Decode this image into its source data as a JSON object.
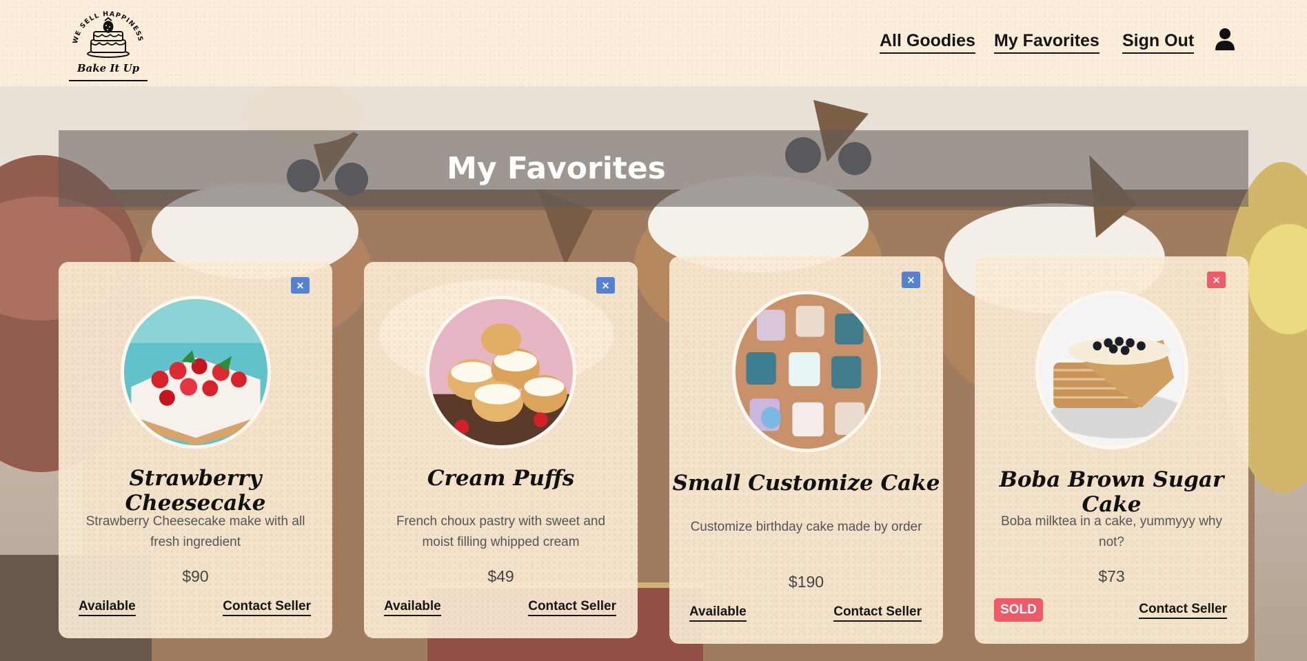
{
  "header": {
    "logo_arc_text": "WE SELL HAPPINESS",
    "logo_script": "Bake It Up",
    "nav": [
      {
        "label": "All Goodies"
      },
      {
        "label": "My Favorites"
      },
      {
        "label": "Sign Out"
      }
    ],
    "user_icon": "user-icon"
  },
  "page": {
    "title": "My Favorites"
  },
  "cards": [
    {
      "name": "Strawberry Cheesecake",
      "description": "Strawberry Cheesecake make with all fresh ingredient",
      "price": "$90",
      "status": "Available",
      "contact": "Contact Seller",
      "remove_icon": "×"
    },
    {
      "name": "Cream Puffs",
      "description": "French choux pastry with sweet and moist filling whipped cream",
      "price": "$49",
      "status": "Available",
      "contact": "Contact Seller",
      "remove_icon": "×"
    },
    {
      "name": "Small Customize Cake",
      "description": "Customize birthday cake made by order",
      "price": "$190",
      "status": "Available",
      "contact": "Contact Seller",
      "remove_icon": "×"
    },
    {
      "name": "Boba Brown Sugar Cake",
      "description": "Boba milktea in a cake, yummyyy why not?",
      "price": "$73",
      "status": "SOLD",
      "contact": "Contact Seller",
      "remove_icon": "×"
    }
  ],
  "colors": {
    "header_bg": "#fbefdc",
    "card_bg": "#faead4",
    "remove_blue": "#5582cf",
    "sold_red": "#ee5a67",
    "title_bar": "#5f5a58"
  }
}
